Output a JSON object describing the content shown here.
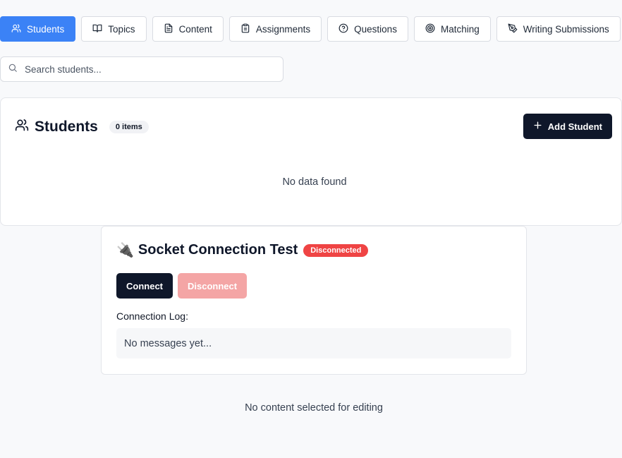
{
  "tabs": [
    {
      "label": "Students",
      "icon": "users-icon",
      "active": true
    },
    {
      "label": "Topics",
      "icon": "book-open-icon"
    },
    {
      "label": "Content",
      "icon": "file-text-icon"
    },
    {
      "label": "Assignments",
      "icon": "clipboard-icon"
    },
    {
      "label": "Questions",
      "icon": "help-circle-icon"
    },
    {
      "label": "Matching",
      "icon": "target-icon"
    },
    {
      "label": "Writing Submissions",
      "icon": "pen-tool-icon"
    }
  ],
  "search": {
    "placeholder": "Search students...",
    "value": ""
  },
  "students_panel": {
    "title": "Students",
    "count_badge": "0 items",
    "add_button_label": "Add Student",
    "empty_message": "No data found"
  },
  "socket_test": {
    "icon": "🔌",
    "title": "Socket Connection Test",
    "status": "Disconnected",
    "connect_label": "Connect",
    "disconnect_label": "Disconnect",
    "log_label": "Connection Log:",
    "log_empty": "No messages yet..."
  },
  "editor": {
    "empty_message": "No content selected for editing"
  },
  "colors": {
    "accent": "#3b82f6",
    "primary_dark": "#0f172a",
    "status_danger": "#ef4444",
    "disabled_danger": "#f4a5a5"
  }
}
